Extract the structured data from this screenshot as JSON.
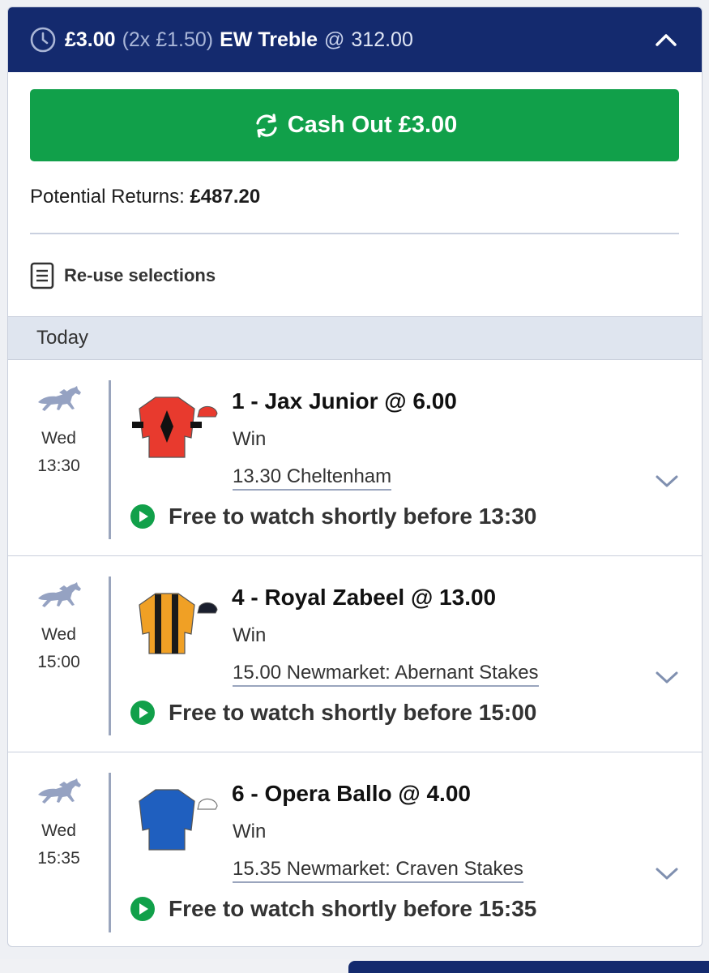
{
  "bet": {
    "stake": "£3.00",
    "stake_split": "(2x £1.50)",
    "bet_type": "EW Treble",
    "at_symbol": "@",
    "total_odds": "312.00"
  },
  "cashout": {
    "label": "Cash Out £3.00"
  },
  "returns": {
    "label": "Potential Returns:",
    "value": "£487.20"
  },
  "reuse": {
    "label": "Re-use selections"
  },
  "section": {
    "label": "Today"
  },
  "selections": [
    {
      "day": "Wed",
      "time": "13:30",
      "title": "1 - Jax Junior @ 6.00",
      "market": "Win",
      "race": "13.30 Cheltenham",
      "watch": "Free to watch shortly before 13:30",
      "silk_colors": {
        "body": "#e83a2e",
        "diamond": "#111111",
        "cap": "#e83a2e"
      }
    },
    {
      "day": "Wed",
      "time": "15:00",
      "title": "4 - Royal Zabeel @ 13.00",
      "market": "Win",
      "race": "15.00 Newmarket: Abernant Stakes",
      "watch": "Free to watch shortly before 15:00",
      "silk_colors": {
        "body": "#f0a025",
        "stripe": "#1a1a1a",
        "cap": "#1a1f2e"
      }
    },
    {
      "day": "Wed",
      "time": "15:35",
      "title": "6 - Opera Ballo @ 4.00",
      "market": "Win",
      "race": "15.35 Newmarket: Craven Stakes",
      "watch": "Free to watch shortly before 15:35",
      "silk_colors": {
        "body": "#1f5fbf",
        "cap": "#ffffff"
      }
    }
  ],
  "colors": {
    "header_bg": "#142a6e",
    "cashout_green": "#11a04a",
    "play_green": "#11a04a",
    "section_bg": "#dfe5ef"
  },
  "icons": [
    "clock-icon",
    "chevron-up-icon",
    "refresh-icon",
    "document-icon",
    "horse-racing-icon",
    "play-icon",
    "chevron-down-icon"
  ]
}
